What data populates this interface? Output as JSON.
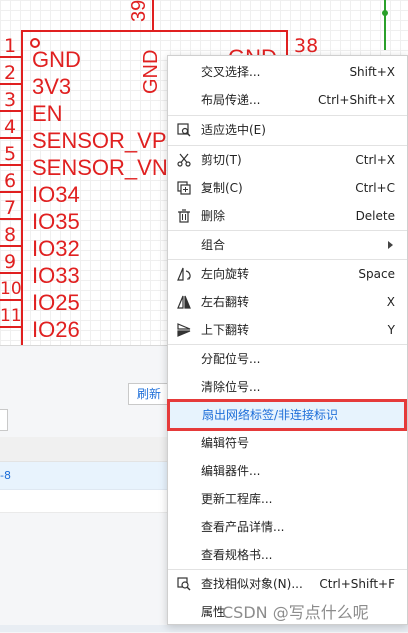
{
  "schematic": {
    "top_pin_number": "39",
    "right_pin_number": "38",
    "rotated_gnd": "GND",
    "right_gnd": "GND",
    "pins": [
      {
        "num": "1",
        "name": "GND"
      },
      {
        "num": "2",
        "name": "3V3"
      },
      {
        "num": "3",
        "name": "EN"
      },
      {
        "num": "4",
        "name": "SENSOR_VP"
      },
      {
        "num": "5",
        "name": "SENSOR_VN"
      },
      {
        "num": "6",
        "name": "IO34"
      },
      {
        "num": "7",
        "name": "IO35"
      },
      {
        "num": "8",
        "name": "IO32"
      },
      {
        "num": "9",
        "name": "IO33"
      },
      {
        "num": "10",
        "name": "IO25"
      },
      {
        "num": "11",
        "name": "IO26"
      }
    ]
  },
  "panel": {
    "refresh_label": "刷新",
    "header_text": "",
    "row_text": "-8"
  },
  "context_menu": {
    "items": [
      {
        "label": "交叉选择...",
        "shortcut": "Shift+X"
      },
      {
        "label": "布局传递...",
        "shortcut": "Ctrl+Shift+X"
      },
      {
        "label": "适应选中(E)",
        "shortcut": ""
      },
      {
        "label": "剪切(T)",
        "shortcut": "Ctrl+X"
      },
      {
        "label": "复制(C)",
        "shortcut": "Ctrl+C"
      },
      {
        "label": "删除",
        "shortcut": "Delete"
      },
      {
        "label": "组合",
        "shortcut": ""
      },
      {
        "label": "左向旋转",
        "shortcut": "Space"
      },
      {
        "label": "左右翻转",
        "shortcut": "X"
      },
      {
        "label": "上下翻转",
        "shortcut": "Y"
      },
      {
        "label": "分配位号...",
        "shortcut": ""
      },
      {
        "label": "清除位号...",
        "shortcut": ""
      },
      {
        "label": "扇出网络标签/非连接标识",
        "shortcut": ""
      },
      {
        "label": "编辑符号",
        "shortcut": ""
      },
      {
        "label": "编辑器件...",
        "shortcut": ""
      },
      {
        "label": "更新工程库...",
        "shortcut": ""
      },
      {
        "label": "查看产品详情...",
        "shortcut": ""
      },
      {
        "label": "查看规格书...",
        "shortcut": ""
      },
      {
        "label": "查找相似对象(N)...",
        "shortcut": "Ctrl+Shift+F"
      },
      {
        "label": "属性",
        "shortcut": ""
      }
    ]
  },
  "watermark": "CSDN @写点什么呢",
  "colors": {
    "schematic_red": "#e02020",
    "wire_green": "#2aa02a",
    "highlight_bg": "#e7f3fd",
    "highlight_border": "#e53a3a",
    "link_blue": "#1e6fd9"
  }
}
